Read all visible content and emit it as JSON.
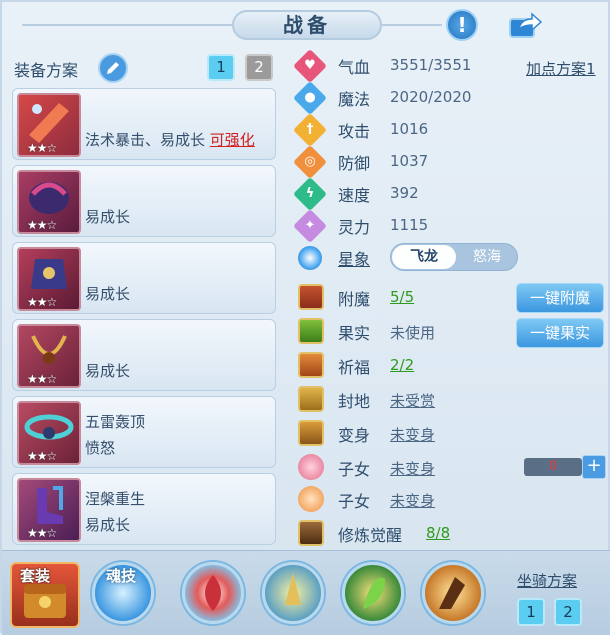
{
  "header": {
    "title": "战备"
  },
  "equipment": {
    "title": "装备方案",
    "plans": [
      "1",
      "2"
    ],
    "items": [
      {
        "line1": "",
        "line2": "法术暴击、易成长",
        "tag": "可强化",
        "stars": "★★☆"
      },
      {
        "line1": "",
        "line2": "易成长",
        "tag": "",
        "stars": "★★☆"
      },
      {
        "line1": "",
        "line2": "易成长",
        "tag": "",
        "stars": "★★☆"
      },
      {
        "line1": "",
        "line2": "易成长",
        "tag": "",
        "stars": "★★☆"
      },
      {
        "line1": "五雷轰顶",
        "line2": "愤怒",
        "tag": "",
        "stars": "★★☆"
      },
      {
        "line1": "涅槃重生",
        "line2": "易成长",
        "tag": "",
        "stars": "★★☆"
      }
    ]
  },
  "attributes": {
    "add_point_plan": "加点方案1",
    "stats": [
      {
        "label": "气血",
        "value": "3551/3551",
        "color": "#e8557a",
        "icon": "heart-icon"
      },
      {
        "label": "魔法",
        "value": "2020/2020",
        "color": "#4aa9ea",
        "icon": "drop-icon"
      },
      {
        "label": "攻击",
        "value": "1016",
        "color": "#f2b132",
        "icon": "sword-icon"
      },
      {
        "label": "防御",
        "value": "1037",
        "color": "#f08f3c",
        "icon": "shield-icon"
      },
      {
        "label": "速度",
        "value": "392",
        "color": "#2dbb8a",
        "icon": "lightning-icon"
      },
      {
        "label": "灵力",
        "value": "1115",
        "color": "#c58be0",
        "icon": "sparkle-icon"
      }
    ],
    "star_sign": {
      "label": "星象",
      "on": "飞龙",
      "off": "怒海"
    }
  },
  "extras": [
    {
      "label": "附魔",
      "value": "5/5"
    },
    {
      "label": "果实",
      "value": "未使用"
    },
    {
      "label": "祈福",
      "value": "2/2"
    },
    {
      "label": "封地",
      "value": "未受赏"
    },
    {
      "label": "变身",
      "value": "未变身"
    },
    {
      "label": "子女",
      "value": "未变身"
    },
    {
      "label": "子女",
      "value": "未变身"
    },
    {
      "label": "修炼觉醒",
      "value": "8/8"
    }
  ],
  "buttons": {
    "enchant": "一键附魔",
    "fruit": "一键果实"
  },
  "counter": {
    "value": "0",
    "plus": "+"
  },
  "bottom": {
    "suit": "套装",
    "soul": "魂技",
    "mount_title": "坐骑方案",
    "mount_plans": [
      "1",
      "2"
    ]
  }
}
